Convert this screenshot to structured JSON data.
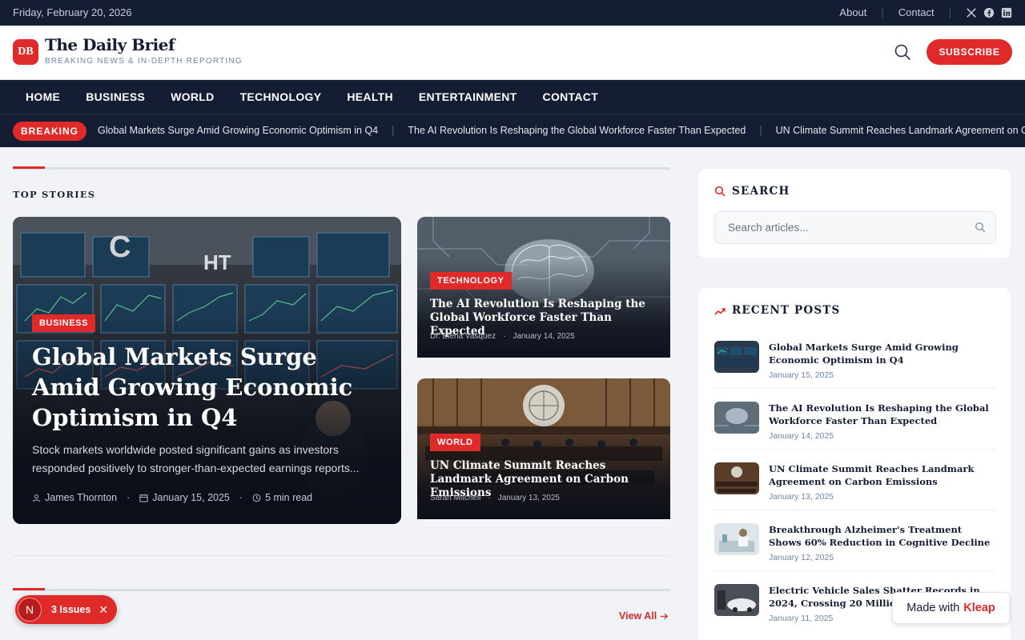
{
  "topbar": {
    "date": "Friday, February 20, 2026",
    "links": [
      "About",
      "Contact"
    ],
    "social_icons": [
      "x-icon",
      "facebook-icon",
      "linkedin-icon"
    ]
  },
  "header": {
    "logo_initials": "DB",
    "title": "The Daily Brief",
    "tagline": "BREAKING NEWS & IN-DEPTH REPORTING",
    "subscribe_label": "SUBSCRIBE"
  },
  "nav": {
    "items": [
      "HOME",
      "BUSINESS",
      "WORLD",
      "TECHNOLOGY",
      "HEALTH",
      "ENTERTAINMENT",
      "CONTACT"
    ]
  },
  "breaking": {
    "label": "BREAKING",
    "headlines": [
      "Global Markets Surge Amid Growing Economic Optimism in Q4",
      "The AI Revolution Is Reshaping the Global Workforce Faster Than Expected",
      "UN Climate Summit Reaches Landmark Agreement on Carbon Emissions"
    ]
  },
  "top_stories": {
    "title": "TOP STORIES",
    "featured": {
      "category": "BUSINESS",
      "title": "Global Markets Surge Amid Growing Economic Optimism in Q4",
      "excerpt": "Stock markets worldwide posted significant gains as investors responded positively to stronger-than-expected earnings reports...",
      "author": "James Thornton",
      "date": "January 15, 2025",
      "read_time": "5 min read"
    },
    "side": [
      {
        "category": "TECHNOLOGY",
        "title": "The AI Revolution Is Reshaping the Global Workforce Faster Than Expected",
        "author": "Dr. Elena Vasquez",
        "date": "January 14, 2025"
      },
      {
        "category": "WORLD",
        "title": "UN Climate Summit Reaches Landmark Agreement on Carbon Emissions",
        "author": "Sarah Mitchell",
        "date": "January 13, 2025"
      }
    ]
  },
  "next_section": {
    "view_all": "View All"
  },
  "sidebar": {
    "search": {
      "title": "SEARCH",
      "placeholder": "Search articles..."
    },
    "recent": {
      "title": "RECENT POSTS",
      "items": [
        {
          "title": "Global Markets Surge Amid Growing Economic Optimism in Q4",
          "date": "January 15, 2025"
        },
        {
          "title": "The AI Revolution Is Reshaping the Global Workforce Faster Than Expected",
          "date": "January 14, 2025"
        },
        {
          "title": "UN Climate Summit Reaches Landmark Agreement on Carbon Emissions",
          "date": "January 13, 2025"
        },
        {
          "title": "Breakthrough Alzheimer's Treatment Shows 60% Reduction in Cognitive Decline",
          "date": "January 12, 2025"
        },
        {
          "title": "Electric Vehicle Sales Shatter Records in 2024, Crossing 20 Million Units",
          "date": "January 11, 2025"
        }
      ]
    }
  },
  "overlays": {
    "issues_avatar": "N",
    "issues_label": "3 Issues",
    "made_with_prefix": "Made with",
    "made_with_brand": "Kleap"
  },
  "colors": {
    "accent": "#e02a2a",
    "navy": "#141d33"
  }
}
